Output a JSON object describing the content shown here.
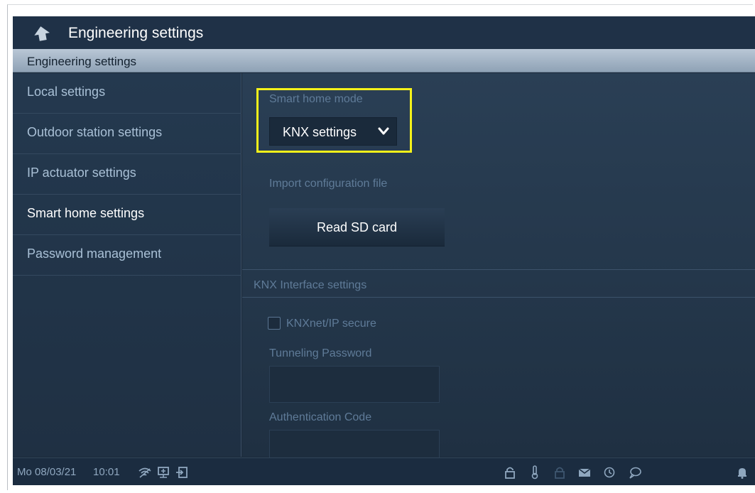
{
  "titlebar": {
    "title": "Engineering settings"
  },
  "section": {
    "title": "Engineering settings"
  },
  "sidebar": {
    "items": [
      {
        "label": "Local settings",
        "active": false
      },
      {
        "label": "Outdoor station settings",
        "active": false
      },
      {
        "label": "IP actuator settings",
        "active": false
      },
      {
        "label": "Smart home settings",
        "active": true
      },
      {
        "label": "Password management",
        "active": false
      }
    ]
  },
  "main": {
    "smart_home_mode_label": "Smart home mode",
    "smart_home_mode_value": "KNX settings",
    "import_label": "Import configuration file",
    "read_sd_button": "Read SD card",
    "knx_interface_header": "KNX Interface settings",
    "knxnet_secure_label": "KNXnet/IP secure",
    "knxnet_secure_checked": false,
    "tunneling_password_label": "Tunneling Password",
    "tunneling_password_value": "",
    "authentication_code_label": "Authentication Code",
    "authentication_code_value": ""
  },
  "statusbar": {
    "date": "Mo 08/03/21",
    "time": "10:01",
    "left_icons": [
      "wifi-icon",
      "network-icon",
      "exit-icon"
    ],
    "right_icons": [
      "lock-icon",
      "thermometer-icon",
      "lock-disabled-icon",
      "mail-icon",
      "history-icon",
      "chat-icon",
      "bell-icon"
    ]
  },
  "colors": {
    "background": "#1c2a3a",
    "highlight": "#f5f21a",
    "label": "#5f7b98",
    "sidebar_text": "#a9c0d6"
  }
}
